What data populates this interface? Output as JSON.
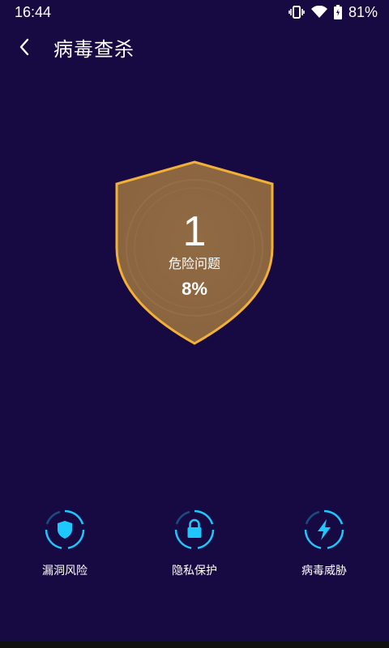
{
  "status_bar": {
    "time": "16:44",
    "battery": "81%"
  },
  "header": {
    "title": "病毒查杀"
  },
  "scan": {
    "count": "1",
    "label": "危险问题",
    "progress": "8%"
  },
  "features": [
    {
      "label": "漏洞风险",
      "icon": "shield-icon"
    },
    {
      "label": "隐私保护",
      "icon": "lock-icon"
    },
    {
      "label": "病毒威胁",
      "icon": "lightning-icon"
    }
  ],
  "colors": {
    "background": "#170a42",
    "shield_fill": "#8a6540",
    "shield_border": "#f2b136",
    "accent": "#1ec8ff"
  }
}
